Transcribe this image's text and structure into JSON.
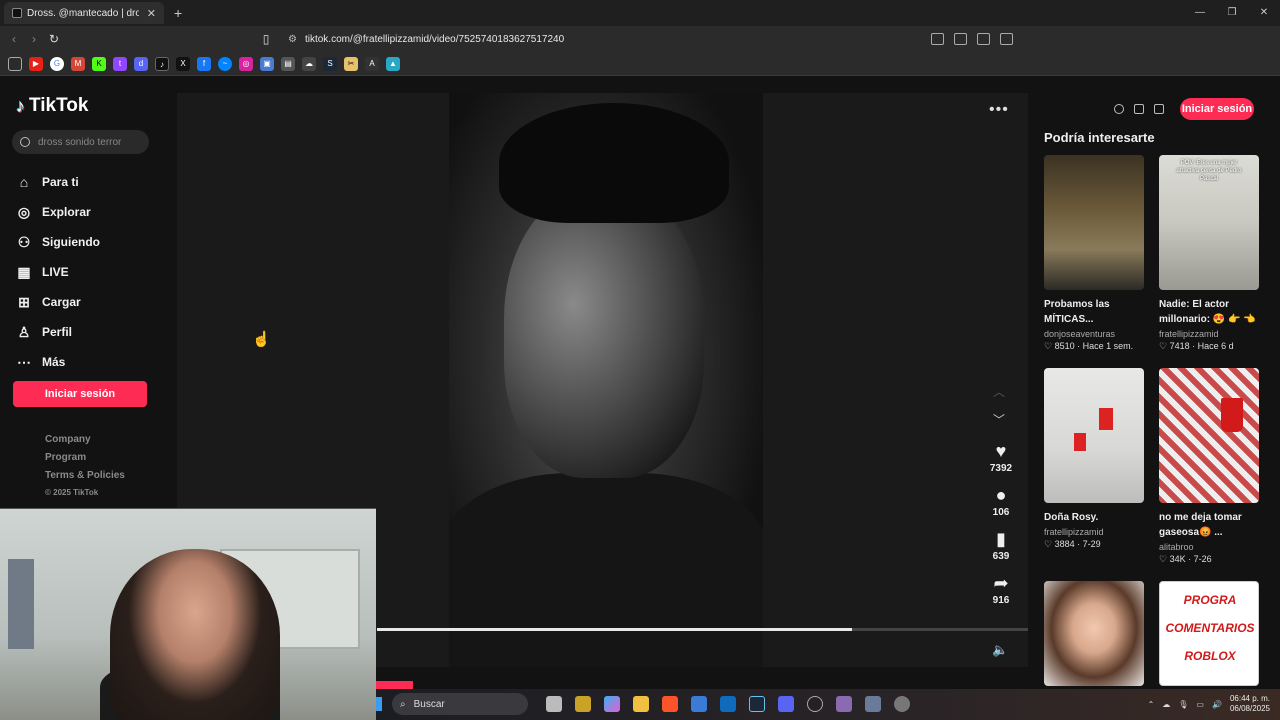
{
  "browser": {
    "tab_title": "Dross. @mantecado | dross |",
    "url": "tiktok.com/@fratellipizzamid/video/7525740183627517240",
    "bookmarks": [
      "youtube",
      "google",
      "gmail",
      "kick",
      "twitch",
      "discord",
      "tiktok",
      "x",
      "facebook",
      "messenger",
      "instagram",
      "store",
      "folder",
      "cloud",
      "steam",
      "ai",
      "ai2",
      "drive"
    ]
  },
  "tiktok": {
    "brand": "TikTok",
    "search_placeholder": "dross sonido terror",
    "nav": [
      {
        "label": "Para ti",
        "icon": "home-icon"
      },
      {
        "label": "Explorar",
        "icon": "compass-icon"
      },
      {
        "label": "Siguiendo",
        "icon": "following-icon"
      },
      {
        "label": "LIVE",
        "icon": "live-icon"
      },
      {
        "label": "Cargar",
        "icon": "upload-icon"
      },
      {
        "label": "Perfil",
        "icon": "profile-icon"
      },
      {
        "label": "Más",
        "icon": "more-icon"
      }
    ],
    "login_label": "Iniciar sesión",
    "footer": [
      "Company",
      "Program",
      "Terms & Policies"
    ],
    "copyright": "© 2025 TikTok",
    "video": {
      "likes": "7392",
      "comments": "106",
      "saves": "639",
      "shares": "916",
      "progress": 0.73
    },
    "recommended_title": "Podría interesarte",
    "recommended": [
      {
        "title": "Probamos las MÍTICAS...",
        "user": "donjoseaventuras",
        "likes": "8510",
        "when": "Hace 1 sem.",
        "thumb_text": ""
      },
      {
        "title": "Nadie: El actor millonario: 😍 👉 👈",
        "user": "fratellipizzamid",
        "likes": "7418",
        "when": "Hace 6 d",
        "thumb_text": "POV: Eres una mujer atractiva cerca de Pedro Pascal"
      },
      {
        "title": "Doña Rosy.",
        "user": "fratellipizzamid",
        "likes": "3884",
        "when": "7-29",
        "thumb_text": ""
      },
      {
        "title": "no me deja tomar gaseosa😡 ...",
        "user": "alitabroo",
        "likes": "34K",
        "when": "7-26",
        "thumb_text": ""
      },
      {
        "title": "",
        "user": "",
        "likes": "",
        "when": "",
        "thumb_text": ""
      },
      {
        "title": "",
        "user": "",
        "likes": "",
        "when": "",
        "thumb_text": "PROGRA COMENTARIOS ROBLOX"
      }
    ]
  },
  "taskbar": {
    "search_label": "Buscar",
    "time": "06:44 p. m.",
    "date": "06/08/2025"
  }
}
